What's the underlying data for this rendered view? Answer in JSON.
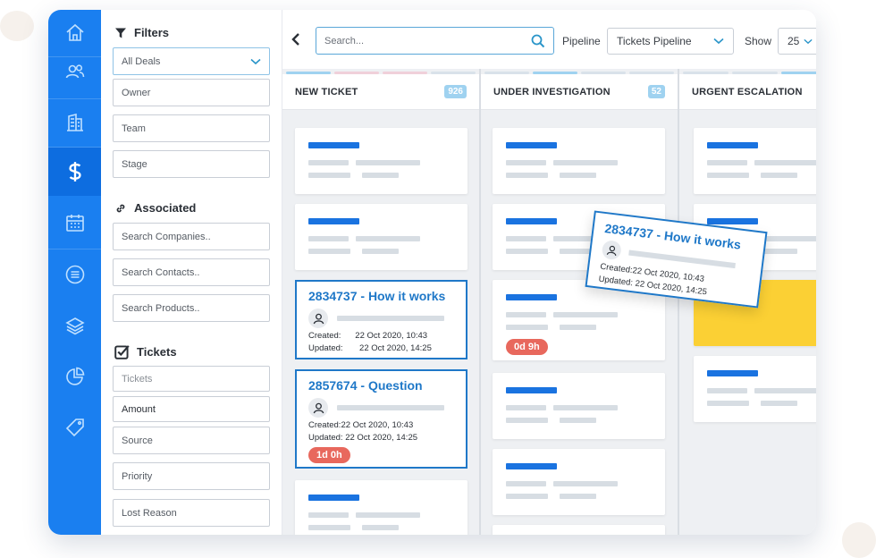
{
  "rail": {
    "items": [
      "home-icon",
      "contacts-icon",
      "companies-icon",
      "deals-icon",
      "calendar-icon",
      "tasks-icon",
      "layers-icon",
      "reports-icon",
      "tags-icon"
    ],
    "active_item": "deals-icon",
    "colors": {
      "rail": "#1a7ff0",
      "active": "#0d6de0"
    }
  },
  "filters": {
    "title": "Filters",
    "deal_select": "All Deals",
    "fields": [
      "Owner",
      "Team",
      "Stage"
    ],
    "associated_title": "Associated",
    "associated_fields": [
      "Search Companies..",
      "Search Contacts..",
      "Search Products.."
    ],
    "tickets_title": "Tickets",
    "ticket_fields": [
      "Tickets",
      "Amount",
      "Source",
      "Priority",
      "Lost Reason"
    ]
  },
  "topbar": {
    "search_placeholder": "Search...",
    "pipeline_label": "Pipeline",
    "pipeline_value": "Tickets Pipeline",
    "show_label": "Show",
    "show_value": "25"
  },
  "columns": [
    {
      "title": "NEW TICKET",
      "count": "926"
    },
    {
      "title": "UNDER INVESTIGATION",
      "count": "52"
    },
    {
      "title": "URGENT ESCALATION",
      "count": ""
    }
  ],
  "tickets": [
    {
      "title": "2834737 - How it works",
      "created_label": "Created:",
      "created": "22 Oct 2020, 10:43",
      "updated_label": "Updated:",
      "updated": "22 Oct 2020, 14:25"
    },
    {
      "title": "2857674 - Question",
      "created_label": "Created:",
      "created": "22 Oct 2020, 10:43",
      "updated_label": "Updated:",
      "updated": "22 Oct 2020, 14:25",
      "sla": "1d 0h"
    }
  ],
  "floating_ticket": {
    "title": "2834737 - How it works",
    "created_label": "Created:",
    "created": "22 Oct 2020, 10:43",
    "updated_label": "Updated:",
    "updated": "22 Oct 2020, 14:25"
  },
  "investigation_sla": "0d 9h",
  "colors": {
    "accent": "#1a73e0",
    "sla": "#e8685d",
    "highlight": "#fbd034"
  }
}
